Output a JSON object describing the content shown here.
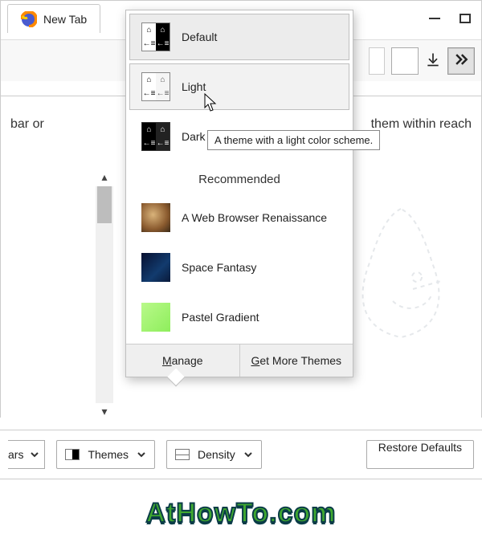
{
  "tab": {
    "title": "New Tab"
  },
  "content": {
    "left_fragment": "bar or",
    "right_fragment": "them within reach"
  },
  "themes_popup": {
    "builtin": [
      {
        "label": "Default"
      },
      {
        "label": "Light"
      },
      {
        "label": "Dark"
      }
    ],
    "tooltip": "A theme with a light color scheme.",
    "section_title": "Recommended",
    "recommended": [
      {
        "label": "A Web Browser Renaissance"
      },
      {
        "label": "Space Fantasy"
      },
      {
        "label": "Pastel Gradient"
      }
    ],
    "footer": {
      "manage": "Manage",
      "get_more": "Get More Themes"
    }
  },
  "customize_bar": {
    "first_fragment": "ars",
    "themes": "Themes",
    "density": "Density",
    "restore": "Restore Defaults"
  },
  "watermark": "AtHowTo.com"
}
